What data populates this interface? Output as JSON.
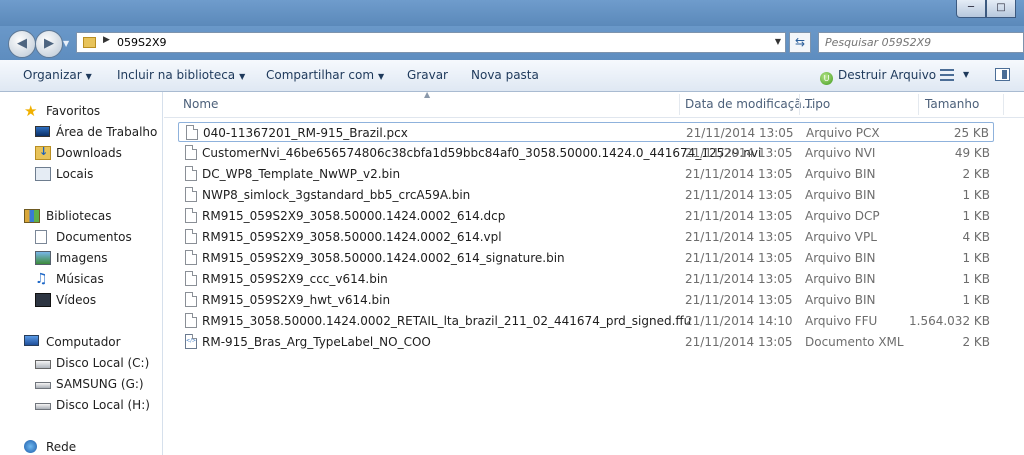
{
  "window": {
    "controls": [
      "─",
      "□"
    ]
  },
  "address": {
    "path": "059S2X9",
    "search_placeholder": "Pesquisar 059S2X9"
  },
  "toolbar": {
    "organize": "Organizar",
    "include_library": "Incluir na biblioteca",
    "share": "Compartilhar com",
    "burn": "Gravar",
    "new_folder": "Nova pasta",
    "destroy": "Destruir Arquivo"
  },
  "sidebar": {
    "favorites": "Favoritos",
    "favorites_items": [
      "Área de Trabalho",
      "Downloads",
      "Locais"
    ],
    "libraries": "Bibliotecas",
    "libraries_items": [
      "Documentos",
      "Imagens",
      "Músicas",
      "Vídeos"
    ],
    "computer": "Computador",
    "computer_items": [
      "Disco Local (C:)",
      "SAMSUNG (G:)",
      "Disco Local (H:)"
    ],
    "network": "Rede"
  },
  "columns": {
    "name": "Nome",
    "date": "Data de modificaçã...",
    "type": "Tipo",
    "size": "Tamanho"
  },
  "files": [
    {
      "name": "040-11367201_RM-915_Brazil.pcx",
      "date": "21/11/2014 13:05",
      "type": "Arquivo PCX",
      "size": "25 KB"
    },
    {
      "name": "CustomerNvi_46be656574806c38cbfa1d59bbc84af0_3058.50000.1424.0_441674_12529.nvi",
      "date": "21/11/2014 13:05",
      "type": "Arquivo NVI",
      "size": "49 KB"
    },
    {
      "name": "DC_WP8_Template_NwWP_v2.bin",
      "date": "21/11/2014 13:05",
      "type": "Arquivo BIN",
      "size": "2 KB"
    },
    {
      "name": "NWP8_simlock_3gstandard_bb5_crcA59A.bin",
      "date": "21/11/2014 13:05",
      "type": "Arquivo BIN",
      "size": "1 KB"
    },
    {
      "name": "RM915_059S2X9_3058.50000.1424.0002_614.dcp",
      "date": "21/11/2014 13:05",
      "type": "Arquivo DCP",
      "size": "1 KB"
    },
    {
      "name": "RM915_059S2X9_3058.50000.1424.0002_614.vpl",
      "date": "21/11/2014 13:05",
      "type": "Arquivo VPL",
      "size": "4 KB"
    },
    {
      "name": "RM915_059S2X9_3058.50000.1424.0002_614_signature.bin",
      "date": "21/11/2014 13:05",
      "type": "Arquivo BIN",
      "size": "1 KB"
    },
    {
      "name": "RM915_059S2X9_ccc_v614.bin",
      "date": "21/11/2014 13:05",
      "type": "Arquivo BIN",
      "size": "1 KB"
    },
    {
      "name": "RM915_059S2X9_hwt_v614.bin",
      "date": "21/11/2014 13:05",
      "type": "Arquivo BIN",
      "size": "1 KB"
    },
    {
      "name": "RM915_3058.50000.1424.0002_RETAIL_lta_brazil_211_02_441674_prd_signed.ffu",
      "date": "21/11/2014 14:10",
      "type": "Arquivo FFU",
      "size": "1.564.032 KB"
    },
    {
      "name": "RM-915_Bras_Arg_TypeLabel_NO_COO",
      "date": "21/11/2014 13:05",
      "type": "Documento XML",
      "size": "2 KB"
    }
  ],
  "file_icons": [
    "document-icon",
    "document-icon",
    "document-icon",
    "document-icon",
    "document-icon",
    "document-icon",
    "document-icon",
    "document-icon",
    "document-icon",
    "document-icon",
    "xml-document-icon"
  ]
}
